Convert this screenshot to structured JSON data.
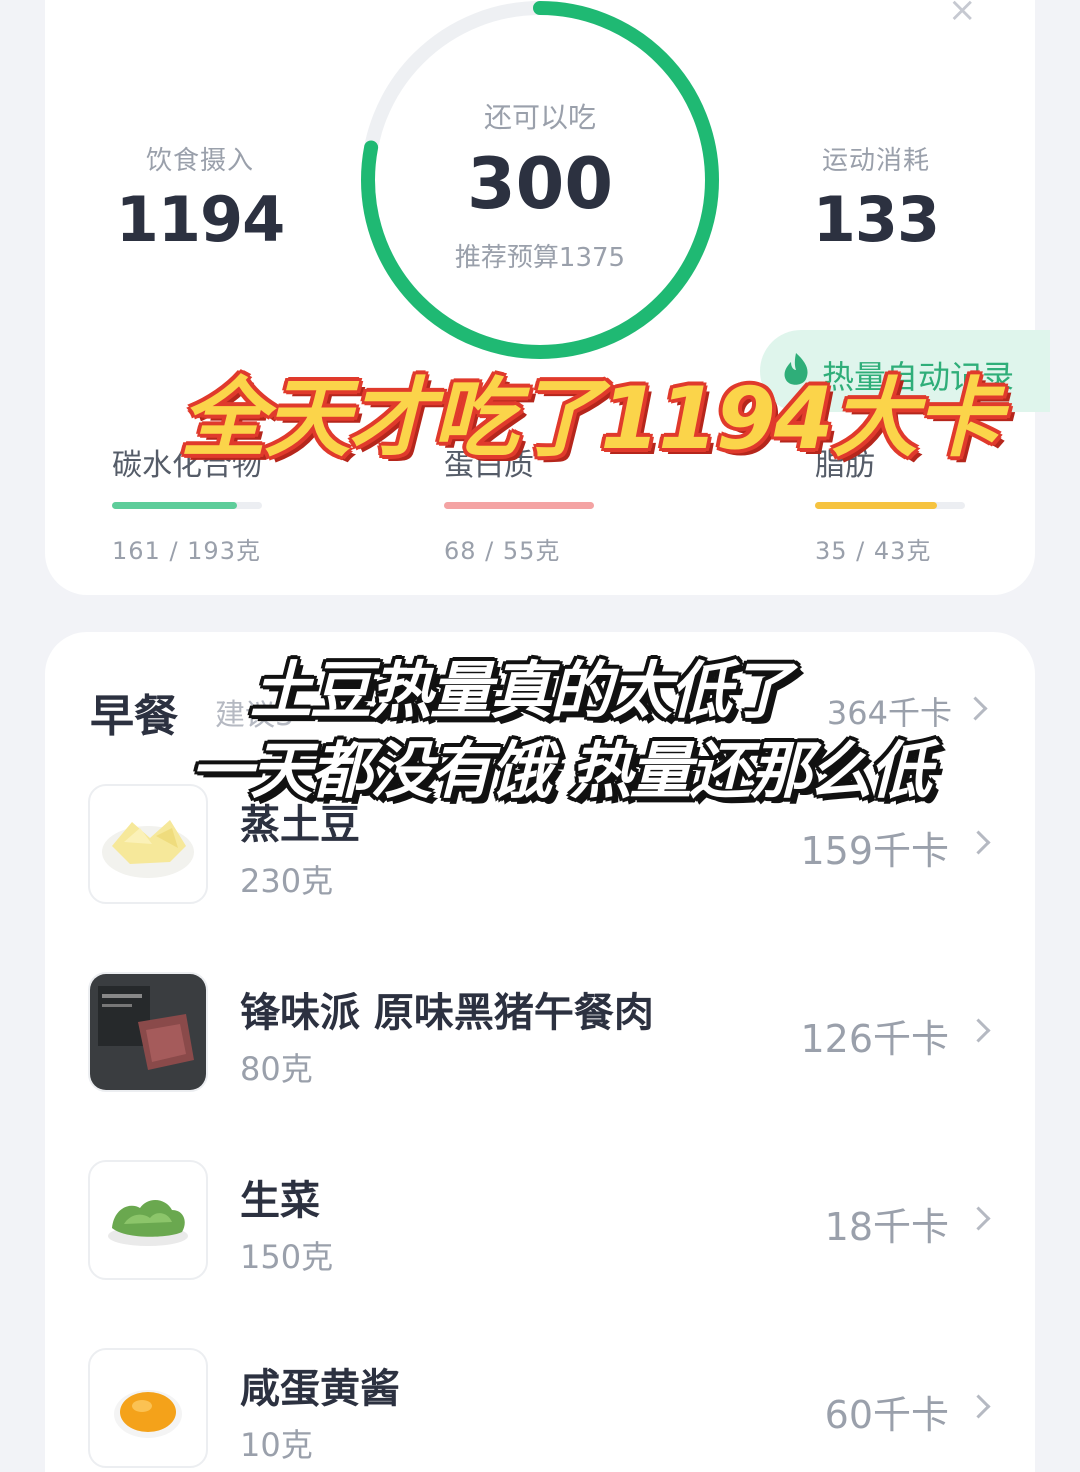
{
  "summary": {
    "close_glyph": "×",
    "intake": {
      "label": "饮食摄入",
      "value": "1194"
    },
    "remaining": {
      "label": "还可以吃",
      "value": "300",
      "budget": "推荐预算1375",
      "progress": 0.78
    },
    "burn": {
      "label": "运动消耗",
      "value": "133"
    },
    "auto_record": {
      "label": "热量自动记录",
      "icon": "flame-leaf-icon"
    },
    "macros": [
      {
        "name": "碳水化合物",
        "amount": "161 / 193克",
        "progress": 0.83,
        "color": "#5dcd9a"
      },
      {
        "name": "蛋白质",
        "amount": "68 / 55克",
        "progress": 1.0,
        "color": "#f4a3a3"
      },
      {
        "name": "脂肪",
        "amount": "35 / 43克",
        "progress": 0.81,
        "color": "#f6c33f"
      }
    ]
  },
  "meal": {
    "title": "早餐",
    "suggest": "建议3",
    "total": "364千卡",
    "items": [
      {
        "name": "蒸土豆",
        "amount": "230克",
        "kcal": "159千卡",
        "thumb": "steamed-potato"
      },
      {
        "name": "锋味派 原味黑猪午餐肉",
        "amount": "80克",
        "kcal": "126千卡",
        "thumb": "luncheon-meat"
      },
      {
        "name": "生菜",
        "amount": "150克",
        "kcal": "18千卡",
        "thumb": "lettuce"
      },
      {
        "name": "咸蛋黄酱",
        "amount": "10克",
        "kcal": "60千卡",
        "thumb": "egg-yolk-sauce"
      }
    ]
  },
  "overlay": {
    "headline": "全天才吃了1194大卡",
    "line1": "土豆热量真的太低了",
    "line2": "一天都没有饿 热量还那么低"
  },
  "colors": {
    "ring": "#1fb973",
    "ring_track": "#eef0f3",
    "accent": "#2fae79"
  }
}
